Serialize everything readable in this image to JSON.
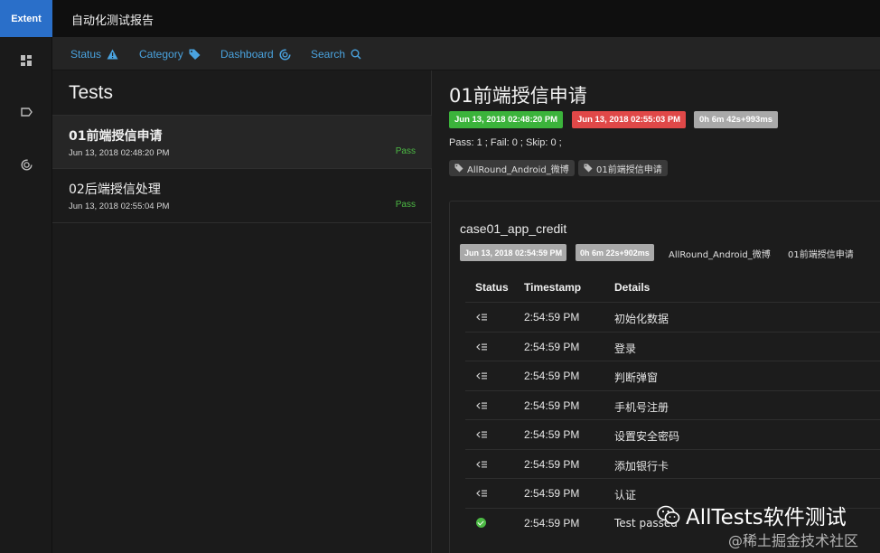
{
  "brand": "Extent",
  "report_title": "自动化测试报告",
  "nav": {
    "status": "Status",
    "category": "Category",
    "dashboard": "Dashboard",
    "search": "Search"
  },
  "tests_panel": {
    "heading": "Tests",
    "items": [
      {
        "name": "01前端授信申请",
        "time": "Jun 13, 2018 02:48:20 PM",
        "status": "Pass"
      },
      {
        "name": "02后端授信处理",
        "time": "Jun 13, 2018 02:55:04 PM",
        "status": "Pass"
      }
    ]
  },
  "detail": {
    "title": "01前端授信申请",
    "start_badge": "Jun 13, 2018 02:48:20 PM",
    "end_badge": "Jun 13, 2018 02:55:03 PM",
    "duration_badge": "0h 6m 42s+993ms",
    "summary": "Pass: 1 ; Fail: 0 ; Skip: 0 ;",
    "tags": [
      "AllRound_Android_微博",
      "01前端授信申请"
    ],
    "case": {
      "name": "case01_app_credit",
      "time_badge": "Jun 13, 2018 02:54:59 PM",
      "duration_badge": "0h 6m 22s+902ms",
      "meta1": "AllRound_Android_微博",
      "meta2": "01前端授信申请",
      "columns": {
        "status": "Status",
        "timestamp": "Timestamp",
        "details": "Details"
      },
      "rows": [
        {
          "status": "info",
          "timestamp": "2:54:59 PM",
          "details": "初始化数据"
        },
        {
          "status": "info",
          "timestamp": "2:54:59 PM",
          "details": "登录"
        },
        {
          "status": "info",
          "timestamp": "2:54:59 PM",
          "details": "判断弹窗"
        },
        {
          "status": "info",
          "timestamp": "2:54:59 PM",
          "details": "手机号注册"
        },
        {
          "status": "info",
          "timestamp": "2:54:59 PM",
          "details": "设置安全密码"
        },
        {
          "status": "info",
          "timestamp": "2:54:59 PM",
          "details": "添加银行卡"
        },
        {
          "status": "info",
          "timestamp": "2:54:59 PM",
          "details": "认证"
        },
        {
          "status": "pass",
          "timestamp": "2:54:59 PM",
          "details": "Test passed"
        }
      ]
    }
  },
  "watermark": {
    "main": "AllTests软件测试",
    "sub": "@稀土掘金技术社区"
  },
  "colors": {
    "accent": "#2a6fc9",
    "link": "#4aa3df",
    "pass": "#4cb944",
    "fail": "#e04848",
    "neutral": "#a9a9a9"
  }
}
